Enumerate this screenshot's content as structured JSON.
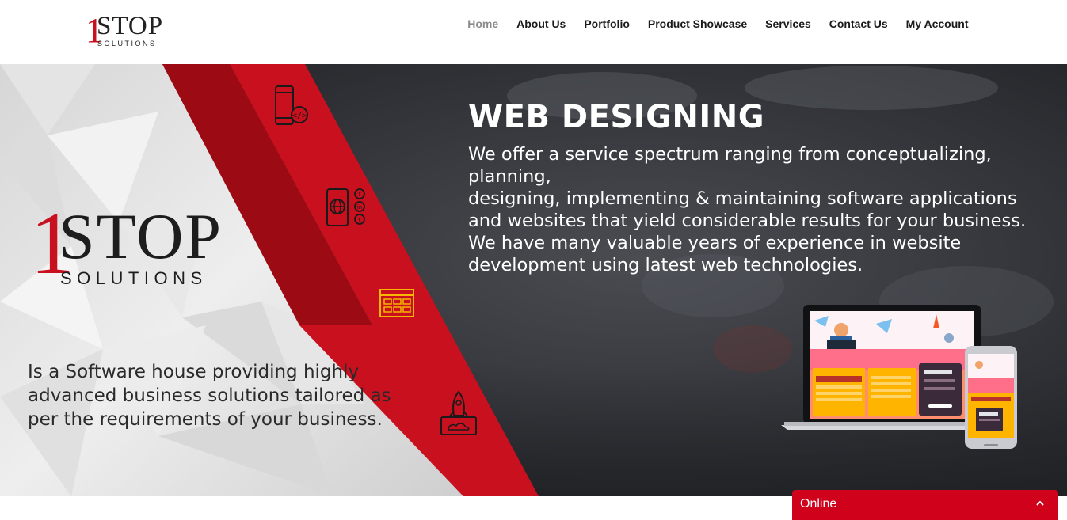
{
  "header": {
    "logo": {
      "one": "1",
      "stop": "STOP",
      "solutions": "SOLUTIONS"
    },
    "nav": [
      {
        "label": "Home",
        "active": true
      },
      {
        "label": "About Us"
      },
      {
        "label": "Portfolio"
      },
      {
        "label": "Product Showcase"
      },
      {
        "label": "Services"
      },
      {
        "label": "Contact Us"
      },
      {
        "label": "My Account"
      }
    ]
  },
  "hero": {
    "logo": {
      "one": "1",
      "stop": "STOP",
      "solutions": "SOLUTIONS"
    },
    "tagline": "Is a Software house providing highly advanced business solutions tailored as per the requirements of your business.",
    "title": "WEB DESIGNING",
    "description_lines": [
      "We offer a service spectrum ranging from conceptualizing, planning,",
      "designing, implementing & maintaining software applications",
      "and websites that yield considerable results for your business.",
      "We have many valuable years of experience in website",
      "development using latest web technologies."
    ],
    "icons": [
      "mobile-code-icon",
      "social-media-icon",
      "web-layout-icon",
      "rocket-launch-icon"
    ]
  },
  "chat": {
    "label": "Online",
    "chevron": "chevron-up-icon"
  },
  "colors": {
    "brand_red": "#c8101f",
    "dark_red": "#9c0a14",
    "chat_red": "#d0021b",
    "icon_yellow": "#f5b700"
  }
}
